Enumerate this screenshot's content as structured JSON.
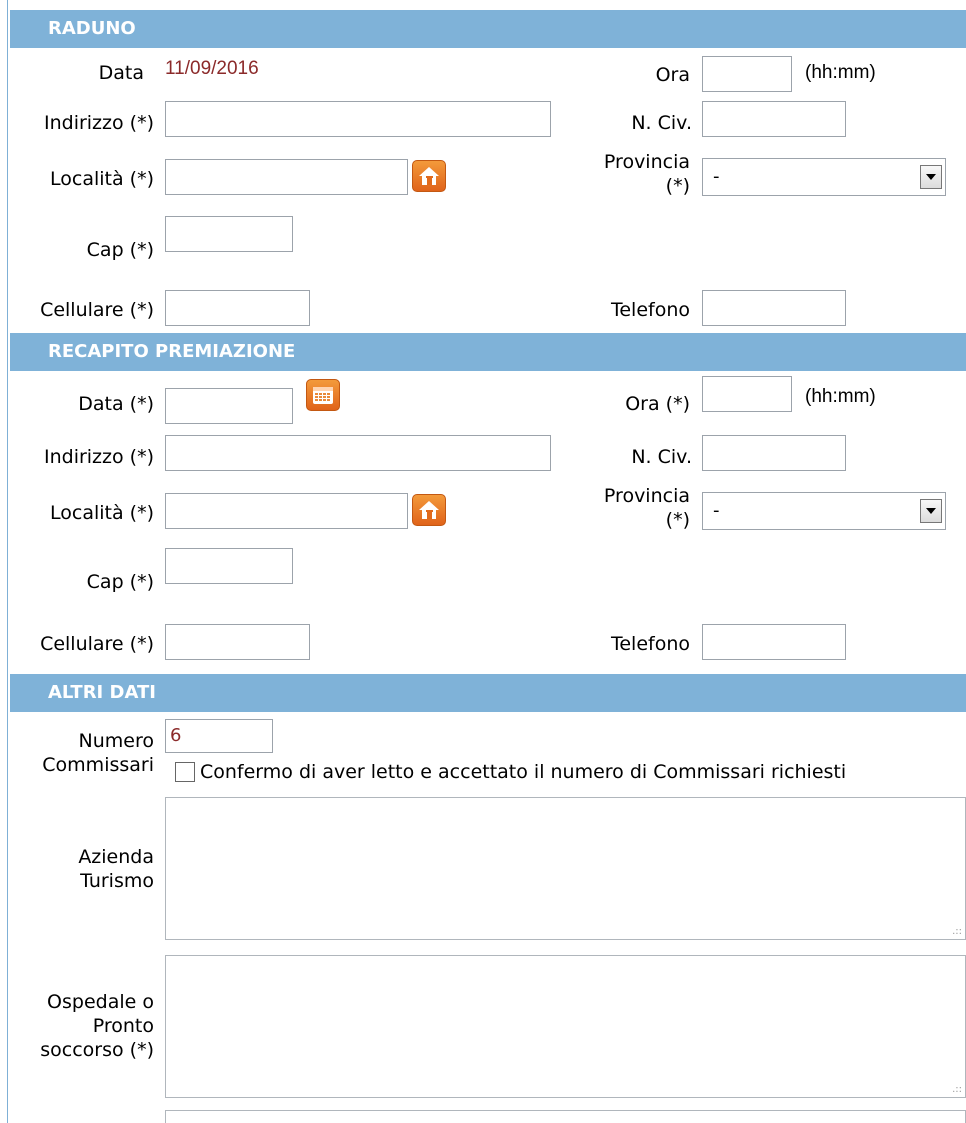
{
  "raduno": {
    "header": "RADUNO",
    "data_label": "Data",
    "data_value": "11/09/2016",
    "ora_label": "Ora",
    "ora_hint": "(hh:mm)",
    "indirizzo_label": "Indirizzo (*)",
    "ncivico_label": "N. Civ.",
    "localita_label": "Località (*)",
    "provincia_label_1": "Provincia",
    "provincia_label_2": "(*)",
    "provincia_value": "-",
    "cap_label": "Cap (*)",
    "cellulare_label": "Cellulare (*)",
    "telefono_label": "Telefono"
  },
  "premiazione": {
    "header": "RECAPITO PREMIAZIONE",
    "data_label": "Data (*)",
    "ora_label": "Ora (*)",
    "ora_hint": "(hh:mm)",
    "indirizzo_label": "Indirizzo (*)",
    "ncivico_label": "N. Civ.",
    "localita_label": "Località (*)",
    "provincia_label_1": "Provincia",
    "provincia_label_2": "(*)",
    "provincia_value": "-",
    "cap_label": "Cap (*)",
    "cellulare_label": "Cellulare (*)",
    "telefono_label": "Telefono"
  },
  "altri": {
    "header": "ALTRI DATI",
    "numero_label_1": "Numero",
    "numero_label_2": "Commissari",
    "numero_value": "6",
    "conferma_label": "Confermo di aver letto e accettato il numero di Commissari richiesti",
    "azienda_label_1": "Azienda",
    "azienda_label_2": "Turismo",
    "ospedale_label_1": "Ospedale o",
    "ospedale_label_2": "Pronto",
    "ospedale_label_3": "soccorso (*)"
  },
  "icons": {
    "home": "home-icon",
    "calendar": "calendar-icon"
  },
  "colors": {
    "header_bg": "#7fb2d8",
    "value_text": "#8b2a2a",
    "icon_orange": "#e97a27"
  }
}
